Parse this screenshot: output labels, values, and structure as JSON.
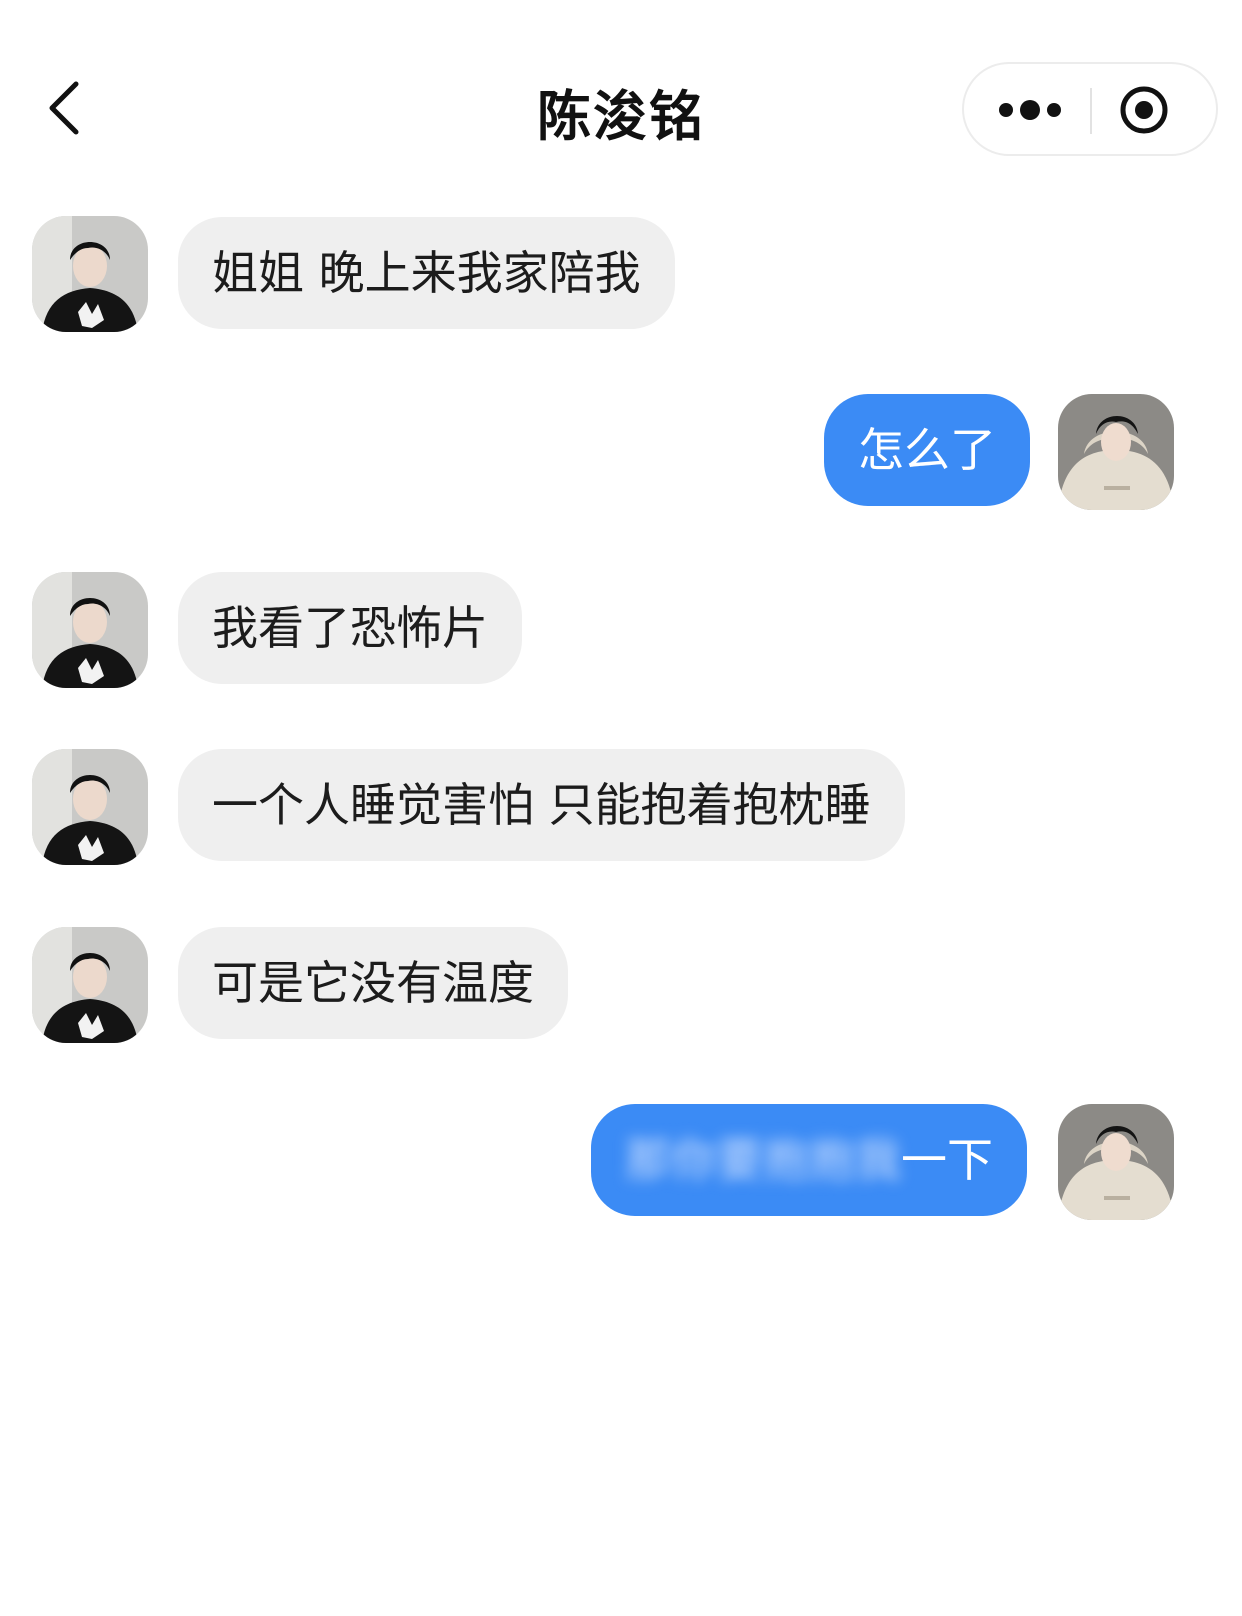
{
  "header": {
    "title": "陈浚铭",
    "back_icon": "chevron-left-icon",
    "more_icon": "more-dots-icon",
    "close_icon": "target-circle-icon"
  },
  "colors": {
    "incoming_bubble": "#efefef",
    "outgoing_bubble": "#3b8bf5",
    "text_dark": "#1c1c1c"
  },
  "messages": [
    {
      "sender": "contact",
      "text": "姐姐 晚上来我家陪我"
    },
    {
      "sender": "me",
      "text": "怎么了"
    },
    {
      "sender": "contact",
      "text": "我看了恐怖片"
    },
    {
      "sender": "contact",
      "text": "一个人睡觉害怕 只能抱着抱枕睡"
    },
    {
      "sender": "contact",
      "text": "可是它没有温度"
    },
    {
      "sender": "me",
      "text_visible": "一下",
      "text_blurred": "那你要抱抱我"
    }
  ]
}
